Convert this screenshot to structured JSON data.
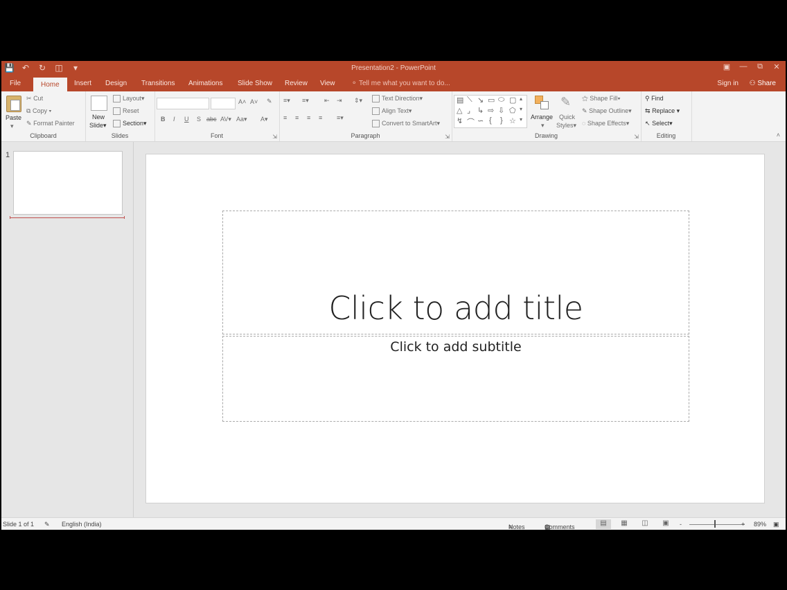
{
  "app": {
    "title": "Presentation2 - PowerPoint",
    "brand_color": "#b7472a"
  },
  "qat": {
    "save_icon": "save-icon",
    "undo_icon": "undo-icon",
    "redo_icon": "redo-icon",
    "start_icon": "start-from-beginning-icon",
    "customize_icon": "customize-qat-icon"
  },
  "tabs": [
    "File",
    "Home",
    "Insert",
    "Design",
    "Transitions",
    "Animations",
    "Slide Show",
    "Review",
    "View"
  ],
  "active_tab": "Home",
  "tell_me": "Tell me what you want to do...",
  "sign_in": "Sign in",
  "share": "Share",
  "ribbon": {
    "clipboard": {
      "label": "Clipboard",
      "paste": "Paste",
      "cut": "Cut",
      "copy": "Copy",
      "format_painter": "Format Painter"
    },
    "slides": {
      "label": "Slides",
      "new_slide_1": "New",
      "new_slide_2": "Slide",
      "layout": "Layout",
      "reset": "Reset",
      "section": "Section"
    },
    "font": {
      "label": "Font",
      "bold": "B",
      "italic": "I",
      "underline": "U",
      "shadow": "S",
      "strike": "abc",
      "spacing": "AV",
      "case": "Aa",
      "color": "A",
      "grow": "A",
      "shrink": "A"
    },
    "paragraph": {
      "label": "Paragraph",
      "text_direction": "Text Direction",
      "align_text": "Align Text",
      "convert_smartart": "Convert to SmartArt"
    },
    "drawing": {
      "label": "Drawing",
      "arrange": "Arrange",
      "quick_styles_1": "Quick",
      "quick_styles_2": "Styles",
      "shape_fill": "Shape Fill",
      "shape_outline": "Shape Outline",
      "shape_effects": "Shape Effects"
    },
    "editing": {
      "label": "Editing",
      "find": "Find",
      "replace": "Replace",
      "select": "Select"
    }
  },
  "thumbnails": {
    "slide_number": "1"
  },
  "slide": {
    "title_placeholder": "Click to add title",
    "subtitle_placeholder": "Click to add subtitle"
  },
  "status": {
    "slide_info": "Slide 1 of 1",
    "language": "English (India)",
    "notes": "Notes",
    "comments": "Comments",
    "zoom": "89%",
    "zoom_minus": "-",
    "zoom_plus": "+",
    "zoom_level": 0.45
  }
}
